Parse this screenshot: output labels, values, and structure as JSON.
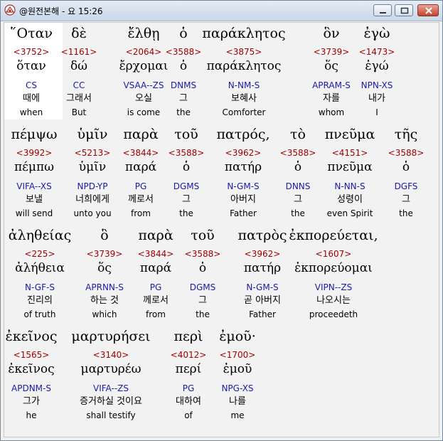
{
  "window": {
    "title": "@원전본해 - 요 15:26"
  },
  "rows": [
    {
      "words": [
        {
          "greek": "῞Οταν",
          "strongs": "<3752>",
          "lemma": "ὅταν",
          "morph": "CS",
          "korean": "때에",
          "english": "when"
        },
        {
          "greek": "δὲ",
          "strongs": "<1161>",
          "lemma": "δώ",
          "morph": "CC",
          "korean": "그래서",
          "english": "But"
        },
        {
          "greek": "ἔλθῃ",
          "strongs": "<2064>",
          "lemma": "ἔρχομαι",
          "morph": "VSAA--ZS",
          "korean": "오실",
          "english": "is come"
        },
        {
          "greek": "ὁ",
          "strongs": "<3588>",
          "lemma": "ὁ",
          "morph": "DNMS",
          "korean": "그",
          "english": "the"
        },
        {
          "greek": "παράκλητος",
          "strongs": "<3875>",
          "lemma": "παράκλητος",
          "morph": "N-NM-S",
          "korean": "보혜사",
          "english": "Comforter"
        },
        {
          "greek": "ὃν",
          "strongs": "<3739>",
          "lemma": "ὅς",
          "morph": "APRAM-S",
          "korean": "자를",
          "english": "whom"
        },
        {
          "greek": "ἐγὼ",
          "strongs": "<1473>",
          "lemma": "ἐγώ",
          "morph": "NPN-XS",
          "korean": "내가",
          "english": "I"
        }
      ]
    },
    {
      "words": [
        {
          "greek": "πέμψω",
          "strongs": "<3992>",
          "lemma": "πέμπω",
          "morph": "VIFA--XS",
          "korean": "보낼",
          "english": "will send"
        },
        {
          "greek": "ὑμῖν",
          "strongs": "<5213>",
          "lemma": "ὑμῖν",
          "morph": "NPD-YP",
          "korean": "너희에게",
          "english": "unto you"
        },
        {
          "greek": "παρὰ",
          "strongs": "<3844>",
          "lemma": "παρά",
          "morph": "PG",
          "korean": "께로서",
          "english": "from"
        },
        {
          "greek": "τοῦ",
          "strongs": "<3588>",
          "lemma": "ὁ",
          "morph": "DGMS",
          "korean": "그",
          "english": "the"
        },
        {
          "greek": "πατρός,",
          "strongs": "<3962>",
          "lemma": "πατήρ",
          "morph": "N-GM-S",
          "korean": "아버지",
          "english": "Father"
        },
        {
          "greek": "τὸ",
          "strongs": "<3588>",
          "lemma": "ὁ",
          "morph": "DNNS",
          "korean": "그",
          "english": "the"
        },
        {
          "greek": "πνεῦμα",
          "strongs": "<4151>",
          "lemma": "πνεῦμα",
          "morph": "N-NN-S",
          "korean": "성령이",
          "english": "even Spirit"
        },
        {
          "greek": "τῆς",
          "strongs": "<3588>",
          "lemma": "ὁ",
          "morph": "DGFS",
          "korean": "그",
          "english": "the"
        }
      ]
    },
    {
      "words": [
        {
          "greek": "ἀληθείας",
          "strongs": "<225>",
          "lemma": "ἀλήθεια",
          "morph": "N-GF-S",
          "korean": "진리의",
          "english": "of truth"
        },
        {
          "greek": "ὃ",
          "strongs": "<3739>",
          "lemma": "ὅς",
          "morph": "APRNN-S",
          "korean": "하는 것",
          "english": "which"
        },
        {
          "greek": "παρὰ",
          "strongs": "<3844>",
          "lemma": "παρά",
          "morph": "PG",
          "korean": "께로서",
          "english": "from"
        },
        {
          "greek": "τοῦ",
          "strongs": "<3588>",
          "lemma": "ὁ",
          "morph": "DGMS",
          "korean": "그",
          "english": "the"
        },
        {
          "greek": "πατρὸς",
          "strongs": "<3962>",
          "lemma": "πατήρ",
          "morph": "N-GM-S",
          "korean": "곧 아버지",
          "english": "Father"
        },
        {
          "greek": "ἐκπορεύεται,",
          "strongs": "<1607>",
          "lemma": "ἐκπορεύομαι",
          "morph": "VIPN--ZS",
          "korean": "나오시는",
          "english": "proceedeth"
        }
      ]
    },
    {
      "words": [
        {
          "greek": "ἐκεῖνος",
          "strongs": "<1565>",
          "lemma": "ἐκεῖνος",
          "morph": "APDNM-S",
          "korean": "그가",
          "english": "he"
        },
        {
          "greek": "μαρτυρήσει",
          "strongs": "<3140>",
          "lemma": "μαρτυρέω",
          "morph": "VIFA--ZS",
          "korean": "증거하실 것이요",
          "english": "shall testify"
        },
        {
          "greek": "περὶ",
          "strongs": "<4012>",
          "lemma": "περί",
          "morph": "PG",
          "korean": "대하여",
          "english": "of"
        },
        {
          "greek": "ἐμοῦ·",
          "strongs": "<1700>",
          "lemma": "ἐμοῦ",
          "morph": "NPG-XS",
          "korean": "나를",
          "english": "me"
        }
      ]
    }
  ]
}
